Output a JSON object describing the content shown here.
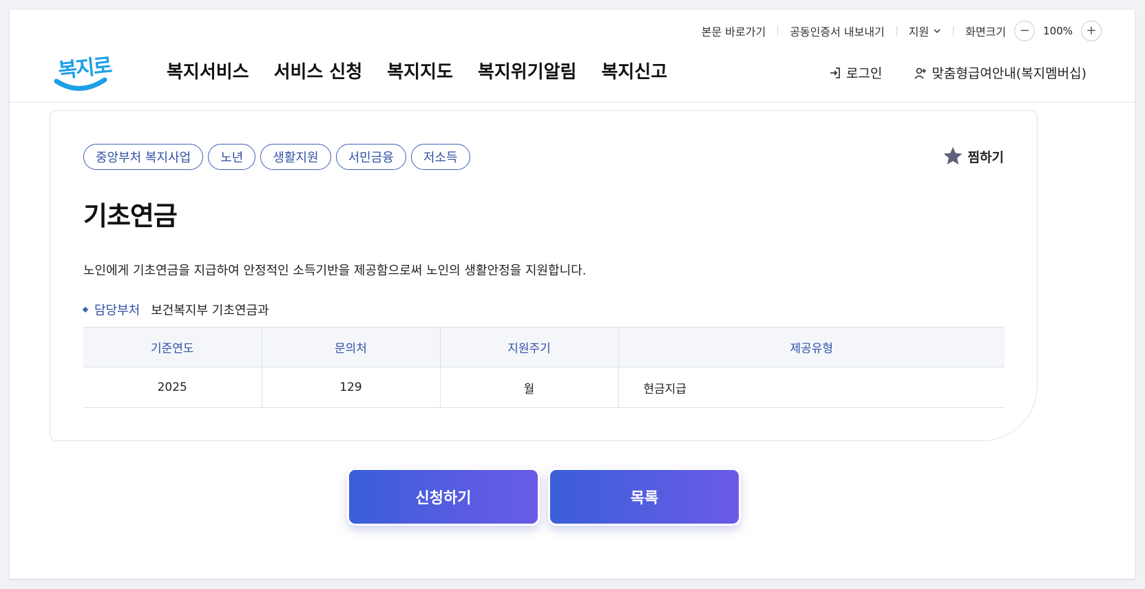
{
  "utility": {
    "skip_link": "본문 바로가기",
    "cert_export": "공동인증서 내보내기",
    "support": "지원",
    "zoom_label": "화면크기",
    "zoom_value": "100%",
    "zoom_out": "−",
    "zoom_in": "+"
  },
  "logo": {
    "text": "복지로"
  },
  "nav": {
    "items": [
      "복지서비스",
      "서비스 신청",
      "복지지도",
      "복지위기알림",
      "복지신고"
    ]
  },
  "header_right": {
    "login": "로그인",
    "membership": "맞춤형급여안내(복지멤버십)"
  },
  "service": {
    "tags": [
      "중앙부처 복지사업",
      "노년",
      "생활지원",
      "서민금융",
      "저소득"
    ],
    "bookmark": "찜하기",
    "title": "기초연금",
    "description": "노인에게 기초연금을 지급하여 안정적인 소득기반을 제공함으로써 노인의 생활안정을 지원합니다.",
    "dept_label": "담당부처",
    "dept_value": "보건복지부 기초연금과",
    "table": {
      "headers": [
        "기준연도",
        "문의처",
        "지원주기",
        "제공유형"
      ],
      "row": [
        "2025",
        "129",
        "월",
        "현금지급"
      ]
    }
  },
  "actions": {
    "apply": "신청하기",
    "list": "목록"
  },
  "colors": {
    "accent": "#3150a6",
    "button_start": "#3b5fd8",
    "button_end": "#6a5be6",
    "logo": "#1e9fe6"
  }
}
